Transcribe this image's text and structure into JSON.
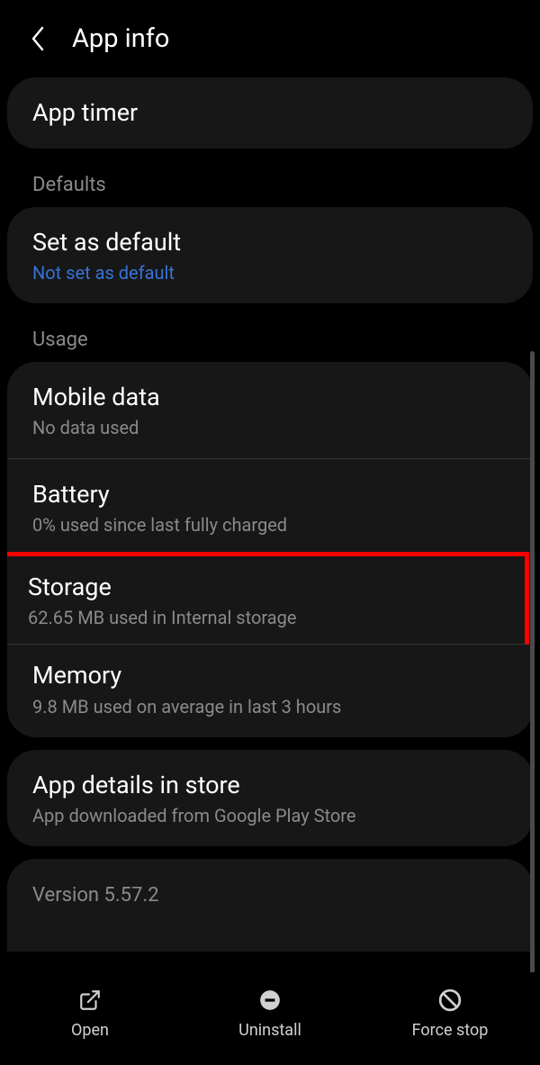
{
  "header": {
    "title": "App info"
  },
  "app_timer": {
    "label": "App timer"
  },
  "sections": {
    "defaults": "Defaults",
    "usage": "Usage"
  },
  "set_default": {
    "title": "Set as default",
    "sub": "Not set as default"
  },
  "mobile_data": {
    "title": "Mobile data",
    "sub": "No data used"
  },
  "battery": {
    "title": "Battery",
    "sub": "0% used since last fully charged"
  },
  "storage": {
    "title": "Storage",
    "sub": "62.65 MB used in Internal storage"
  },
  "memory": {
    "title": "Memory",
    "sub": "9.8 MB used on average in last 3 hours"
  },
  "app_details": {
    "title": "App details in store",
    "sub": "App downloaded from Google Play Store"
  },
  "version": {
    "text": "Version 5.57.2"
  },
  "bottom": {
    "open": "Open",
    "uninstall": "Uninstall",
    "force_stop": "Force stop"
  }
}
